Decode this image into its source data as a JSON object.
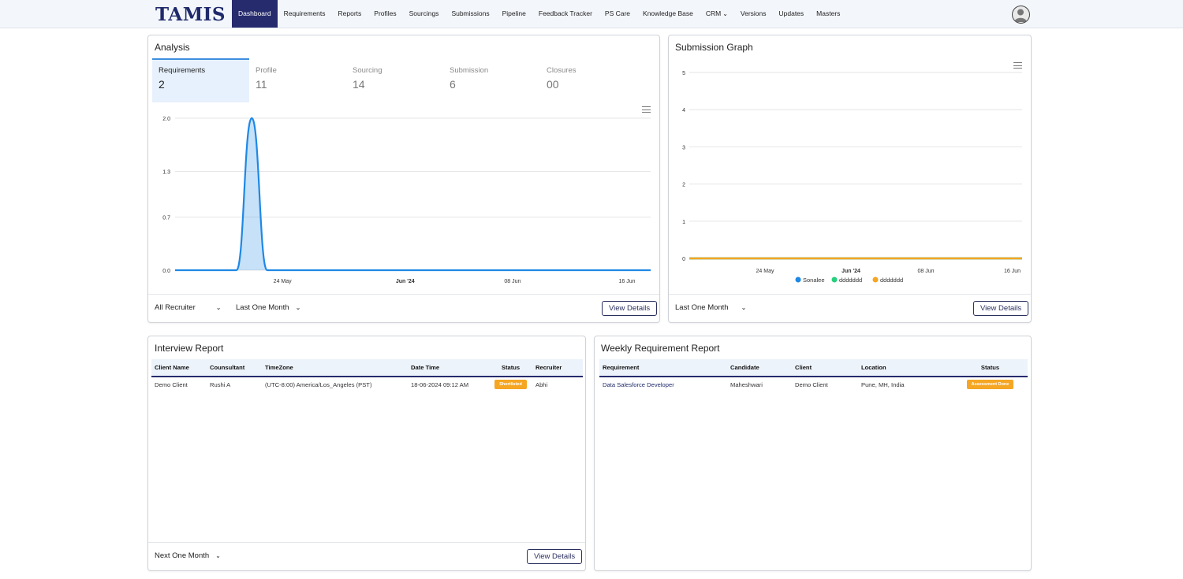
{
  "brand": "TAMIS",
  "nav": {
    "items": [
      "Dashboard",
      "Requirements",
      "Reports",
      "Profiles",
      "Sourcings",
      "Submissions",
      "Pipeline",
      "Feedback Tracker",
      "PS Care",
      "Knowledge Base",
      "CRM",
      "Versions",
      "Updates",
      "Masters"
    ],
    "active": "Dashboard"
  },
  "analysis": {
    "title": "Analysis",
    "tabs": [
      {
        "label": "Requirements",
        "count": "2"
      },
      {
        "label": "Profile",
        "count": "11"
      },
      {
        "label": "Sourcing",
        "count": "14"
      },
      {
        "label": "Submission",
        "count": "6"
      },
      {
        "label": "Closures",
        "count": "00"
      }
    ],
    "recruiter_select": "All Recruiter",
    "period_select": "Last One Month",
    "view_details": "View Details"
  },
  "submission_graph": {
    "title": "Submission Graph",
    "period_select": "Last One Month",
    "view_details": "View Details",
    "legend": [
      {
        "name": "Sonalee",
        "color": "#1e88e5"
      },
      {
        "name": "ddddddd",
        "color": "#26d07c"
      },
      {
        "name": "ddddddd",
        "color": "#f5a623"
      }
    ]
  },
  "interview_report": {
    "title": "Interview Report",
    "columns": [
      "Client Name",
      "Counsultant",
      "TimeZone",
      "Date Time",
      "Status",
      "Recruiter"
    ],
    "rows": [
      {
        "client": "Demo Client",
        "consultant": "Rushi A",
        "timezone": "(UTC-8:00) America/Los_Angeles (PST)",
        "datetime": "18-06-2024 09:12 AM",
        "status": "Shortlisted",
        "recruiter": "Abhi"
      }
    ],
    "period_select": "Next One Month",
    "view_details": "View Details"
  },
  "weekly_report": {
    "title": "Weekly Requirement Report",
    "columns": [
      "Requirement",
      "Candidate",
      "Client",
      "Location",
      "Status"
    ],
    "rows": [
      {
        "requirement": "Data Salesforce Developer",
        "candidate": "Maheshwari",
        "client": "Demo Client",
        "location": "Pune, MH, India",
        "status": "Assessment Done"
      }
    ]
  },
  "chart_data": [
    {
      "type": "area",
      "title": "",
      "x_ticks": [
        "24 May",
        "Jun '24",
        "08 Jun",
        "16 Jun"
      ],
      "y_ticks": [
        "0.0",
        "0.7",
        "1.3",
        "2.0"
      ],
      "ylim": [
        0,
        2
      ],
      "x": [
        "2024-05-17",
        "2024-05-18",
        "2024-05-19",
        "2024-05-20",
        "2024-05-21",
        "2024-05-22",
        "2024-05-23",
        "2024-05-24",
        "2024-05-25",
        "2024-05-26",
        "2024-05-27",
        "2024-05-28",
        "2024-05-29",
        "2024-05-30",
        "2024-05-31",
        "2024-06-01",
        "2024-06-02",
        "2024-06-03",
        "2024-06-04",
        "2024-06-05",
        "2024-06-06",
        "2024-06-07",
        "2024-06-08",
        "2024-06-09",
        "2024-06-10",
        "2024-06-11",
        "2024-06-12",
        "2024-06-13",
        "2024-06-14",
        "2024-06-15",
        "2024-06-16",
        "2024-06-17"
      ],
      "values": [
        0,
        0,
        0,
        0,
        0,
        2,
        0,
        0,
        0,
        0,
        0,
        0,
        0,
        0,
        0,
        0,
        0,
        0,
        0,
        0,
        0,
        0,
        0,
        0,
        0,
        0,
        0,
        0,
        0,
        0,
        0,
        0
      ],
      "color": "#1e88e5",
      "grid": true
    },
    {
      "type": "line",
      "title": "",
      "x_ticks": [
        "24 May",
        "Jun '24",
        "08 Jun",
        "16 Jun"
      ],
      "y_ticks": [
        "0",
        "1",
        "2",
        "3",
        "4",
        "5"
      ],
      "ylim": [
        0,
        5
      ],
      "series": [
        {
          "name": "Sonalee",
          "values": [
            0,
            0
          ]
        },
        {
          "name": "ddddddd",
          "values": [
            0,
            0
          ]
        },
        {
          "name": "ddddddd",
          "values": [
            0,
            0
          ]
        }
      ],
      "legend": "bottom",
      "grid": true
    }
  ]
}
